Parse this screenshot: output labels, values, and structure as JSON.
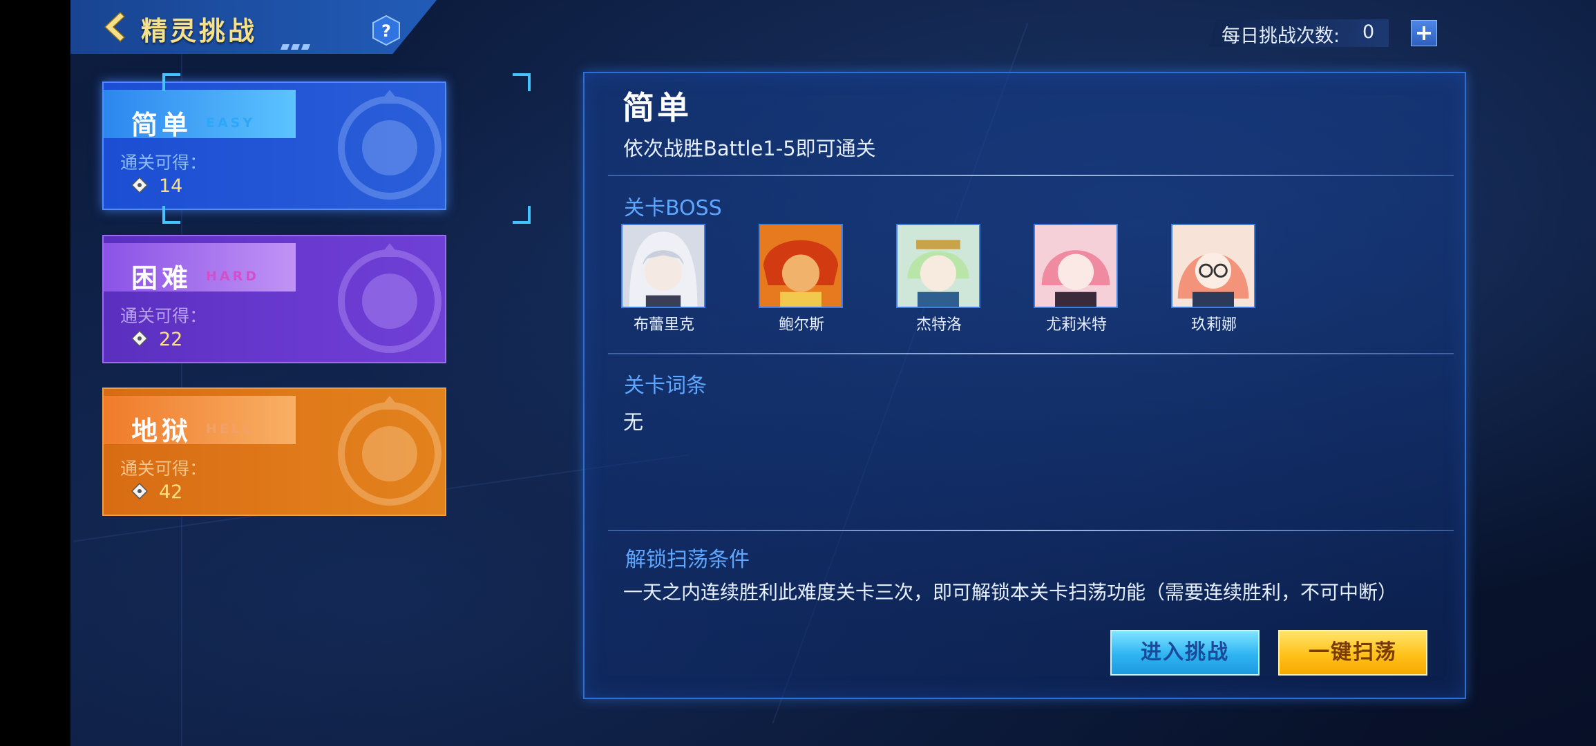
{
  "header": {
    "title": "精灵挑战"
  },
  "attempts": {
    "label": "每日挑战次数:",
    "value": "0"
  },
  "difficulties": [
    {
      "name": "简单",
      "en": "EASY",
      "reward_label": "通关可得：",
      "reward": "14",
      "selected": true
    },
    {
      "name": "困难",
      "en": "HARD",
      "reward_label": "通关可得：",
      "reward": "22",
      "selected": false
    },
    {
      "name": "地狱",
      "en": "HELL",
      "reward_label": "通关可得：",
      "reward": "42",
      "selected": false
    }
  ],
  "detail": {
    "title": "简单",
    "description": "依次战胜Battle1-5即可通关",
    "boss_section": "关卡BOSS",
    "bosses": [
      {
        "name": "布蕾里克"
      },
      {
        "name": "鲍尔斯"
      },
      {
        "name": "杰特洛"
      },
      {
        "name": "尤莉米特"
      },
      {
        "name": "玖莉娜"
      }
    ],
    "terms_section": "关卡词条",
    "terms_value": "无",
    "unlock_section": "解锁扫荡条件",
    "unlock_desc": "一天之内连续胜利此难度关卡三次，即可解锁本关卡扫荡功能（需要连续胜利，不可中断）"
  },
  "buttons": {
    "enter": "进入挑战",
    "sweep": "一键扫荡"
  },
  "colors": {
    "easy": "#2457d6",
    "hard": "#6a3ad0",
    "hell": "#e07a1a",
    "accent": "#43c3ff",
    "title_gold": "#f6e089"
  }
}
